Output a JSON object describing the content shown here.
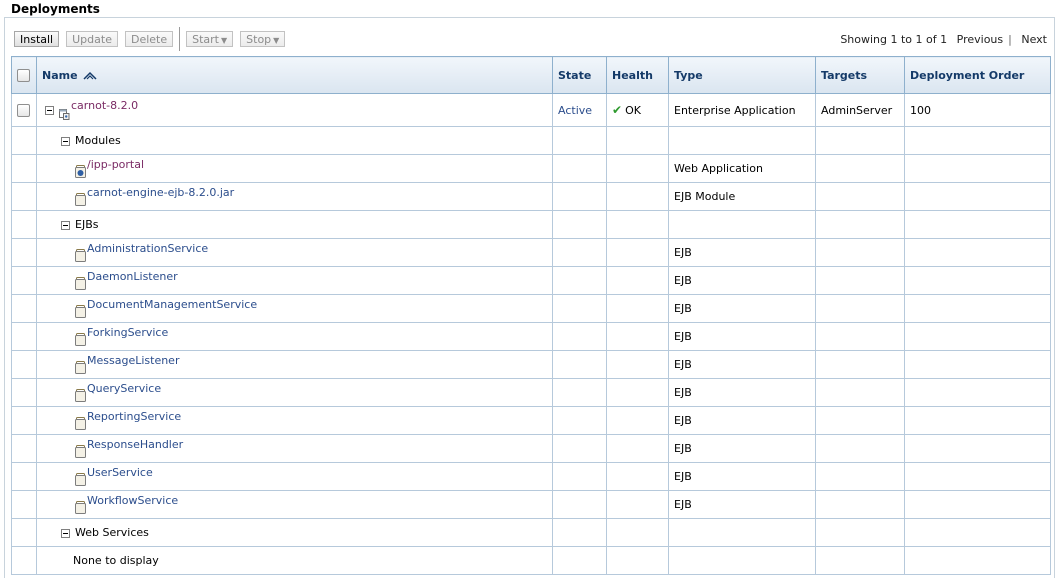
{
  "page": {
    "title": "Deployments"
  },
  "toolbar": {
    "install": "Install",
    "update": "Update",
    "delete": "Delete",
    "start": "Start",
    "stop": "Stop"
  },
  "pager": {
    "showing": "Showing 1 to 1 of 1",
    "previous": "Previous",
    "separator": "|",
    "next": "Next"
  },
  "table": {
    "headers": {
      "name": "Name",
      "state": "State",
      "health": "Health",
      "type": "Type",
      "targets": "Targets",
      "order": "Deployment Order"
    },
    "app": {
      "name": "carnot-8.2.0",
      "state": "Active",
      "health": "OK",
      "type": "Enterprise Application",
      "targets": "AdminServer",
      "order": "100"
    },
    "groups": {
      "modules": "Modules",
      "ejbs": "EJBs",
      "web_services": "Web Services",
      "none": "None to display"
    },
    "modules": [
      {
        "name": "/ipp-portal",
        "type": "Web Application"
      },
      {
        "name": "carnot-engine-ejb-8.2.0.jar",
        "type": "EJB Module"
      }
    ],
    "ejbs": [
      {
        "name": "AdministrationService",
        "type": "EJB"
      },
      {
        "name": "DaemonListener",
        "type": "EJB"
      },
      {
        "name": "DocumentManagementService",
        "type": "EJB"
      },
      {
        "name": "ForkingService",
        "type": "EJB"
      },
      {
        "name": "MessageListener",
        "type": "EJB"
      },
      {
        "name": "QueryService",
        "type": "EJB"
      },
      {
        "name": "ReportingService",
        "type": "EJB"
      },
      {
        "name": "ResponseHandler",
        "type": "EJB"
      },
      {
        "name": "UserService",
        "type": "EJB"
      },
      {
        "name": "WorkflowService",
        "type": "EJB"
      }
    ]
  }
}
